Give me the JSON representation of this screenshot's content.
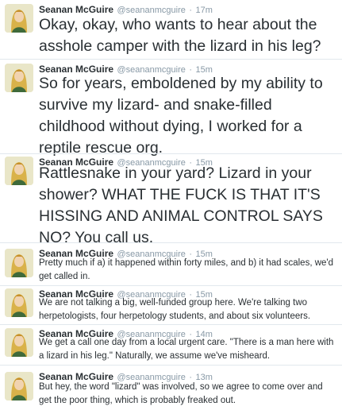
{
  "tweets": [
    {
      "name": "Seanan McGuire",
      "handle": "@seananmcguire",
      "time": "17m",
      "text": "Okay, okay, who wants to hear about the\nasshole camper with the lizard in his leg?"
    },
    {
      "name": "Seanan McGuire",
      "handle": "@seananmcguire",
      "time": "15m",
      "text": "So for years, emboldened by my ability to\nsurvive my lizard- and snake-filled\nchildhood without dying, I worked for a\nreptile rescue org."
    },
    {
      "name": "Seanan McGuire",
      "handle": "@seananmcguire",
      "time": "15m",
      "text": "Rattlesnake in your yard? Lizard in your\nshower? WHAT THE FUCK IS THAT IT'S\nHISSING AND ANIMAL CONTROL SAYS\nNO? You call us."
    },
    {
      "name": "Seanan McGuire",
      "handle": "@seananmcguire",
      "time": "15m",
      "text": "Pretty much if a) it happened within forty miles, and b) it had scales, we'd\nget called in."
    },
    {
      "name": "Seanan McGuire",
      "handle": "@seananmcguire",
      "time": "15m",
      "text": "We are not talking a big, well-funded group here. We're talking two\nherpetologists, four herpetology students, and about six volunteers."
    },
    {
      "name": "Seanan McGuire",
      "handle": "@seananmcguire",
      "time": "14m",
      "text": "We get a call one day from a local urgent care. \"There is a man here with\na lizard in his leg.\" Naturally, we assume we've misheard."
    },
    {
      "name": "Seanan McGuire",
      "handle": "@seananmcguire",
      "time": "13m",
      "text": "But hey, the word \"lizard\" was involved, so we agree to come over and\nget the poor thing, which is probably freaked out."
    }
  ],
  "separator": "·",
  "icons": {
    "avatar": "author-avatar-icon"
  },
  "colors": {
    "name": "#292f33",
    "meta": "#8899a6",
    "divider": "#e1e8ed"
  }
}
